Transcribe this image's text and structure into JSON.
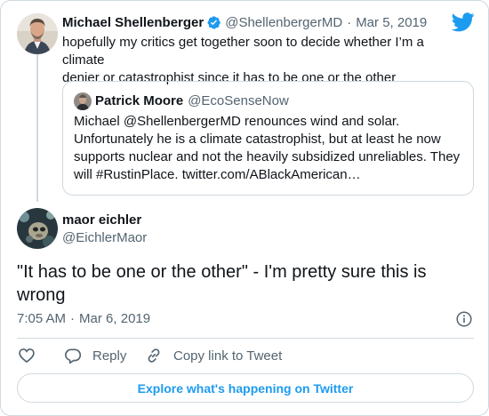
{
  "parent_tweet": {
    "author_name": "Michael Shellenberger",
    "handle": "@ShellenbergerMD",
    "separator": "·",
    "date": "Mar 5, 2019",
    "verified": true,
    "text_line1": "hopefully my critics get together soon to decide whether I’m a climate",
    "text_line2": "denier or catastrophist since it has to be one or the other"
  },
  "quoted_tweet": {
    "author_name": "Patrick Moore",
    "handle": "@EcoSenseNow",
    "lines": [
      "Michael @ShellenbergerMD renounces wind and solar.",
      "Unfortunately he is a climate catastrophist, but at least he now",
      "supports nuclear and not the heavily subsidized unreliables. They",
      "will #RustinPlace. twitter.com/ABlackAmerican…"
    ]
  },
  "main_tweet": {
    "author_name": "maor eichler",
    "handle": "@EichlerMaor",
    "text_line1": "\"It has to be one or the other\" - I'm pretty sure this is",
    "text_line2": "wrong",
    "time": "7:05 AM",
    "separator": "·",
    "date": "Mar 6, 2019"
  },
  "actions": {
    "reply_label": "Reply",
    "copy_link_label": "Copy link to Tweet"
  },
  "explore_label": "Explore what's happening on Twitter",
  "colors": {
    "twitter_blue": "#1d9bf0",
    "text": "#0f1419",
    "muted": "#536471",
    "border": "#cfd9de"
  },
  "icons": [
    "twitter-bird-icon",
    "verified-badge-icon",
    "info-icon",
    "heart-icon",
    "reply-icon",
    "link-icon"
  ]
}
